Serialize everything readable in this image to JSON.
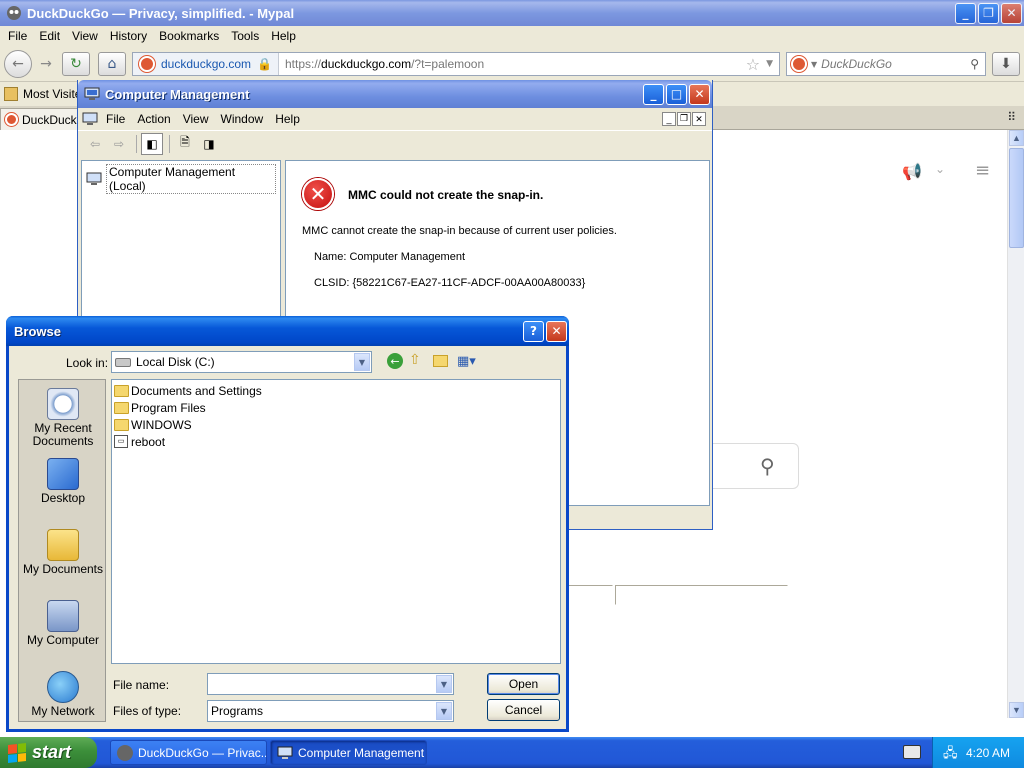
{
  "browser": {
    "title": "DuckDuckGo — Privacy, simplified. - Mypal",
    "menu": [
      "File",
      "Edit",
      "View",
      "History",
      "Bookmarks",
      "Tools",
      "Help"
    ],
    "identity_domain": "duckduckgo.com",
    "url_prefix": "https://",
    "url_host": "duckduckgo.com",
    "url_rest": "/?t=palemoon",
    "search_placeholder": "DuckDuckGo",
    "bookmark_label": "Most Visite",
    "tab_label": "DuckDuckG"
  },
  "mmc": {
    "title": "Computer Management",
    "menu": [
      "File",
      "Action",
      "View",
      "Window",
      "Help"
    ],
    "tree_root": "Computer Management (Local)",
    "error_title": "MMC could not create the snap-in.",
    "error_body": "MMC cannot create the snap-in because of current user policies.",
    "name_line": "Name: Computer Management",
    "clsid_line": "CLSID: {58221C67-EA27-11CF-ADCF-00AA00A80033}"
  },
  "browse": {
    "title": "Browse",
    "look_in_label": "Look in:",
    "look_in_value": "Local Disk (C:)",
    "places": [
      "My Recent Documents",
      "Desktop",
      "My Documents",
      "My Computer",
      "My Network"
    ],
    "files": [
      {
        "name": "Documents and Settings",
        "kind": "folder"
      },
      {
        "name": "Program Files",
        "kind": "folder"
      },
      {
        "name": "WINDOWS",
        "kind": "folder"
      },
      {
        "name": "reboot",
        "kind": "file"
      }
    ],
    "file_name_label": "File name:",
    "file_name_value": "",
    "files_of_type_label": "Files of type:",
    "files_of_type_value": "Programs",
    "open_label": "Open",
    "cancel_label": "Cancel"
  },
  "taskbar": {
    "start_label": "start",
    "items": [
      "DuckDuckGo — Privac...",
      "Computer Management"
    ],
    "clock": "4:20 AM"
  },
  "colors": {
    "xp_title_blue": "#0046c8",
    "ddg_orange": "#de5833",
    "taskbar_blue": "#245edb",
    "start_green": "#3c8f3a"
  }
}
